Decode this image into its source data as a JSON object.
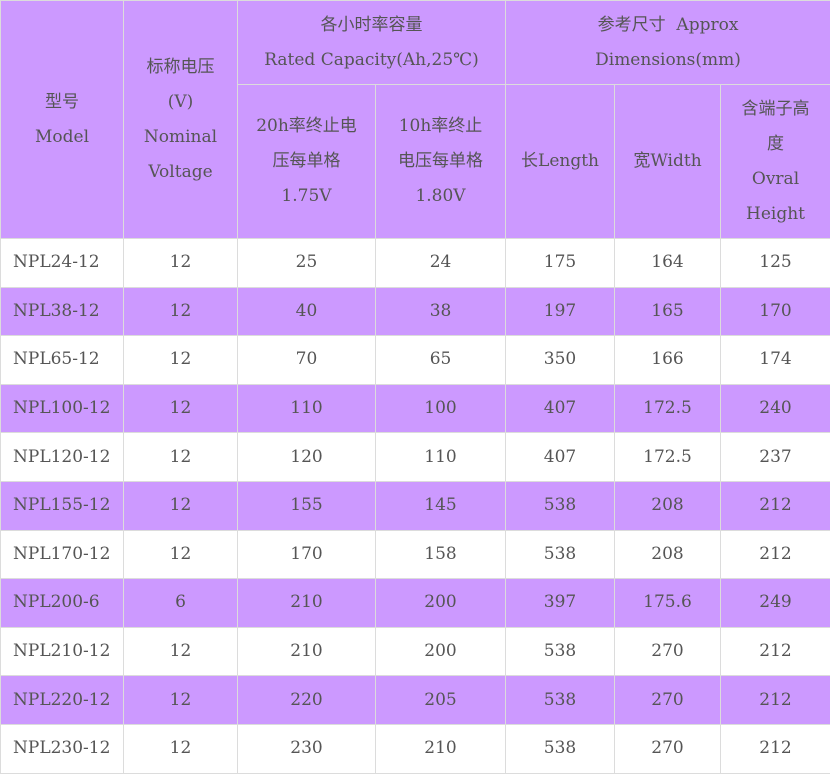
{
  "headers": {
    "model": [
      "型号",
      "Model"
    ],
    "voltage": [
      "标称电压",
      "(V)",
      "Nominal",
      "Voltage"
    ],
    "capacity": [
      "各小时率容量",
      "Rated Capacity(Ah,25℃)"
    ],
    "cap_20h": [
      "20h率终止电",
      "压每单格",
      "1.75V"
    ],
    "cap_10h": [
      "10h率终止",
      "电压每单格",
      "1.80V"
    ],
    "dimensions": [
      "参考尺寸  Approx",
      "Dimensions(mm)"
    ],
    "length": [
      "长Length"
    ],
    "width": [
      "宽Width"
    ],
    "height": [
      "含端子高",
      "度",
      "Ovral",
      "Height"
    ]
  },
  "rows": [
    {
      "model": "NPL24-12",
      "voltage": "12",
      "cap20": "25",
      "cap10": "24",
      "length": "175",
      "width": "164",
      "height": "125"
    },
    {
      "model": "NPL38-12",
      "voltage": "12",
      "cap20": "40",
      "cap10": "38",
      "length": "197",
      "width": "165",
      "height": "170"
    },
    {
      "model": "NPL65-12",
      "voltage": "12",
      "cap20": "70",
      "cap10": "65",
      "length": "350",
      "width": "166",
      "height": "174"
    },
    {
      "model": "NPL100-12",
      "voltage": "12",
      "cap20": "110",
      "cap10": "100",
      "length": "407",
      "width": "172.5",
      "height": "240"
    },
    {
      "model": "NPL120-12",
      "voltage": "12",
      "cap20": "120",
      "cap10": "110",
      "length": "407",
      "width": "172.5",
      "height": "237"
    },
    {
      "model": "NPL155-12",
      "voltage": "12",
      "cap20": "155",
      "cap10": "145",
      "length": "538",
      "width": "208",
      "height": "212"
    },
    {
      "model": "NPL170-12",
      "voltage": "12",
      "cap20": "170",
      "cap10": "158",
      "length": "538",
      "width": "208",
      "height": "212"
    },
    {
      "model": "NPL200-6",
      "voltage": "6",
      "cap20": "210",
      "cap10": "200",
      "length": "397",
      "width": "175.6",
      "height": "249"
    },
    {
      "model": "NPL210-12",
      "voltage": "12",
      "cap20": "210",
      "cap10": "200",
      "length": "538",
      "width": "270",
      "height": "212"
    },
    {
      "model": "NPL220-12",
      "voltage": "12",
      "cap20": "220",
      "cap10": "205",
      "length": "538",
      "width": "270",
      "height": "212"
    },
    {
      "model": "NPL230-12",
      "voltage": "12",
      "cap20": "230",
      "cap10": "210",
      "length": "538",
      "width": "270",
      "height": "212"
    }
  ],
  "colors": {
    "header_bg": "#cc99ff",
    "alt_row_bg": "#cc99ff",
    "plain_row_bg": "#ffffff",
    "text": "#555555",
    "border": "#dcdcdc"
  }
}
